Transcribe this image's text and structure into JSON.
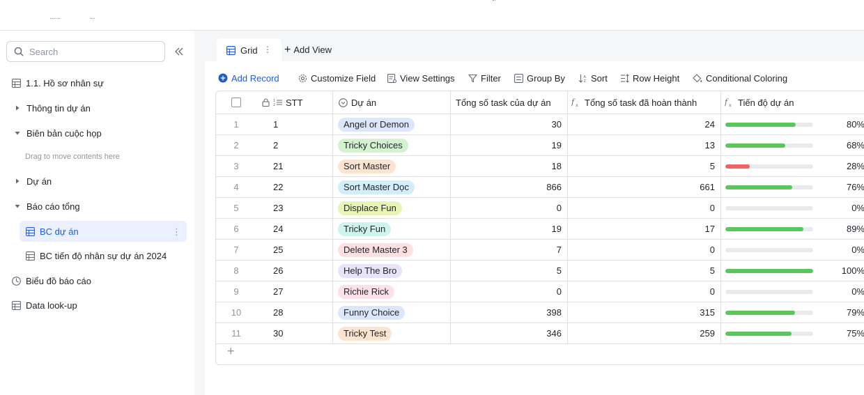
{
  "app": {
    "search_placeholder": "Search"
  },
  "sidebar": {
    "items": [
      {
        "label": "1.1. Hồ sơ nhân sự",
        "icon": "table-icon"
      },
      {
        "label": "Thông tin dự án",
        "icon": "caret-right-icon"
      },
      {
        "label": "Biên bản cuộc họp",
        "icon": "caret-down-icon"
      },
      {
        "label": "Drag to move contents here",
        "icon": ""
      },
      {
        "label": "Dự án",
        "icon": "caret-right-icon"
      },
      {
        "label": "Báo cáo tổng",
        "icon": "caret-down-icon"
      },
      {
        "label": "BC dự án",
        "icon": "table-icon"
      },
      {
        "label": "BC tiến độ nhân sự dự án 2024",
        "icon": "table-icon"
      },
      {
        "label": "Biểu đồ báo cáo",
        "icon": "dashboard-icon"
      },
      {
        "label": "Data look-up",
        "icon": "table-icon"
      }
    ]
  },
  "tabs": {
    "grid_label": "Grid",
    "add_view_label": "Add View"
  },
  "toolbar": {
    "add_record": "Add Record",
    "customize_field": "Customize Field",
    "view_settings": "View Settings",
    "filter": "Filter",
    "group_by": "Group By",
    "sort": "Sort",
    "row_height": "Row Height",
    "conditional_coloring": "Conditional Coloring"
  },
  "table": {
    "columns": [
      "STT",
      "Dự án",
      "Tổng số task của dự án",
      "Tổng số task đã hoàn thành",
      "Tiến độ dự án"
    ],
    "rows": [
      {
        "idx": "1",
        "stt": "1",
        "project": "Angel or Demon",
        "tag_color": "#dde7fb",
        "total": "30",
        "done": "24",
        "progress": 0.8,
        "pct": "80%",
        "bar_color": "#5ac75a"
      },
      {
        "idx": "2",
        "stt": "2",
        "project": "Tricky Choices",
        "tag_color": "#d5f2d0",
        "total": "19",
        "done": "13",
        "progress": 0.68,
        "pct": "68%",
        "bar_color": "#5ac75a"
      },
      {
        "idx": "3",
        "stt": "21",
        "project": "Sort Master",
        "tag_color": "#fde4cf",
        "total": "18",
        "done": "5",
        "progress": 0.28,
        "pct": "28%",
        "bar_color": "#ee6462"
      },
      {
        "idx": "4",
        "stt": "22",
        "project": "Sort Master Dọc",
        "tag_color": "#d2eefa",
        "total": "866",
        "done": "661",
        "progress": 0.76,
        "pct": "76%",
        "bar_color": "#5ac75a"
      },
      {
        "idx": "5",
        "stt": "23",
        "project": "Displace Fun",
        "tag_color": "#e6f5b3",
        "total": "0",
        "done": "0",
        "progress": 0,
        "pct": "0%",
        "bar_color": "#5ac75a"
      },
      {
        "idx": "6",
        "stt": "24",
        "project": "Tricky Fun",
        "tag_color": "#cff3ed",
        "total": "19",
        "done": "17",
        "progress": 0.89,
        "pct": "89%",
        "bar_color": "#5ac75a"
      },
      {
        "idx": "7",
        "stt": "25",
        "project": "Delete Master 3",
        "tag_color": "#fde0df",
        "total": "7",
        "done": "0",
        "progress": 0,
        "pct": "0%",
        "bar_color": "#5ac75a"
      },
      {
        "idx": "8",
        "stt": "26",
        "project": "Help The Bro",
        "tag_color": "#e9e2fb",
        "total": "5",
        "done": "5",
        "progress": 1.0,
        "pct": "100%",
        "bar_color": "#5ac75a"
      },
      {
        "idx": "9",
        "stt": "27",
        "project": "Richie Rick",
        "tag_color": "#fde0e8",
        "total": "0",
        "done": "0",
        "progress": 0,
        "pct": "0%",
        "bar_color": "#5ac75a"
      },
      {
        "idx": "10",
        "stt": "28",
        "project": "Funny Choice",
        "tag_color": "#dde7fb",
        "total": "398",
        "done": "315",
        "progress": 0.79,
        "pct": "79%",
        "bar_color": "#5ac75a"
      },
      {
        "idx": "11",
        "stt": "30",
        "project": "Tricky Test",
        "tag_color": "#fde4cf",
        "total": "346",
        "done": "259",
        "progress": 0.75,
        "pct": "75%",
        "bar_color": "#5ac75a"
      }
    ]
  },
  "colors": {
    "accent": "#245bdb",
    "active_bg": "#eaf0fd",
    "progress_good": "#5ac75a",
    "progress_bad": "#ee6462"
  }
}
